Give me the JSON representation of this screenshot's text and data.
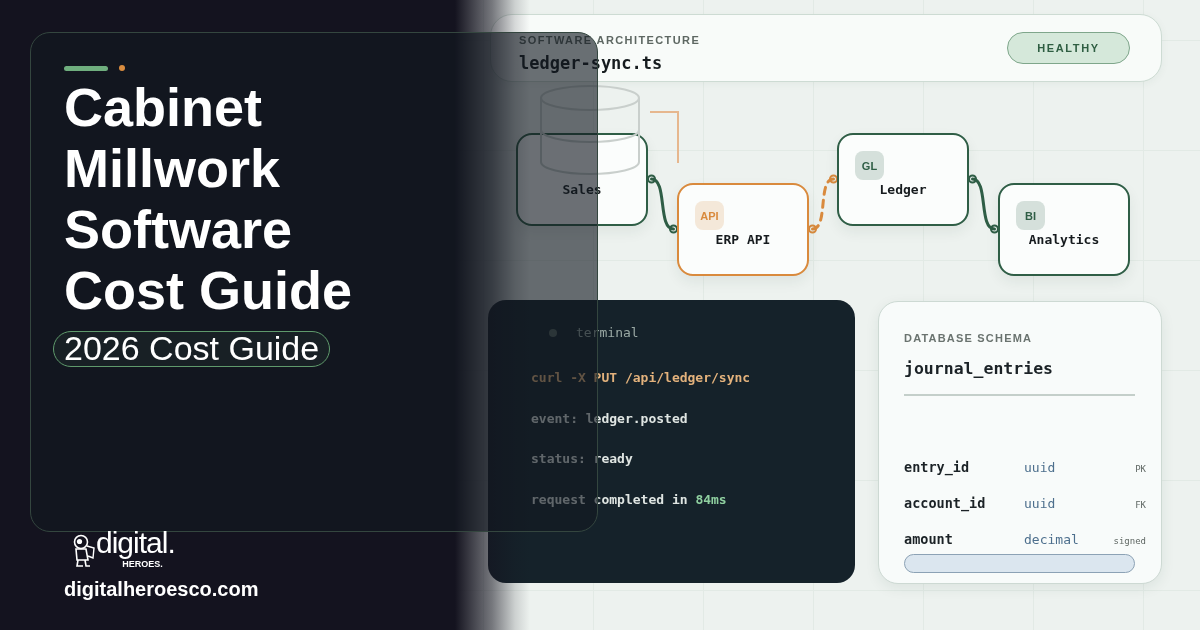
{
  "hero": {
    "title": "Cabinet Millwork Software Cost Guide",
    "subtitle": "2026 Cost Guide"
  },
  "brand": {
    "wordmark": "digital.",
    "tagline": "HEROES.",
    "url": "digitalheroesco.com"
  },
  "architecture": {
    "eyebrow": "SOFTWARE ARCHITECTURE",
    "file": "ledger-sync.ts",
    "status": "HEALTHY"
  },
  "diagram": {
    "nodes": [
      {
        "label": "Sales",
        "color": "#2f5e46"
      },
      {
        "badge": "API",
        "label": "ERP API",
        "color": "#d98a3d"
      },
      {
        "badge": "GL",
        "label": "Ledger",
        "color": "#2f5e46"
      },
      {
        "badge": "BI",
        "label": "Analytics",
        "color": "#2f5e46"
      }
    ],
    "edges": [
      {
        "kind": "solid",
        "color": "#2f5e46"
      },
      {
        "kind": "dashed",
        "color": "#d98a3d"
      },
      {
        "kind": "solid",
        "color": "#2f5e46"
      }
    ]
  },
  "terminal": {
    "title": "terminal",
    "lines": [
      [
        {
          "text": "curl -X PUT /api/ledger/sync",
          "kind": "command"
        }
      ],
      [
        {
          "text": "event: ledger.posted",
          "kind": "plain"
        }
      ],
      [
        {
          "text": "status: ready",
          "kind": "plain"
        }
      ],
      [
        {
          "text": "request completed in ",
          "kind": "plain"
        },
        {
          "text": "84ms",
          "kind": "success"
        }
      ]
    ]
  },
  "schema": {
    "eyebrow": "DATABASE SCHEMA",
    "table": "journal_entries",
    "columns": [
      {
        "name": "entry_id",
        "type": "uuid",
        "flag": "PK"
      },
      {
        "name": "account_id",
        "type": "uuid",
        "flag": "FK"
      },
      {
        "name": "amount",
        "type": "decimal",
        "flag": "signed"
      }
    ]
  }
}
